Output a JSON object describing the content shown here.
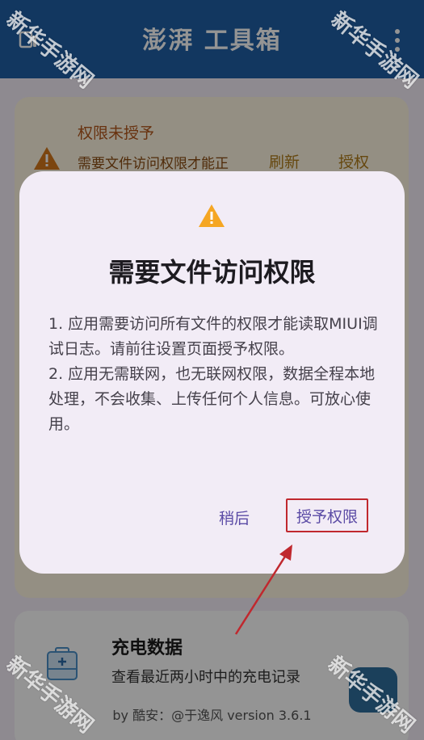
{
  "appbar": {
    "title": "澎湃 工具箱"
  },
  "warning_card": {
    "title": "权限未授予",
    "text": "需要文件访问权限才能正",
    "refresh_label": "刷新",
    "grant_label": "授权",
    "icon": "warning-icon"
  },
  "charge_card": {
    "title": "充电数据",
    "subtitle": "查看最近两小时中的充电记录",
    "icon": "battery-medical-icon"
  },
  "footer": {
    "text": "by 酷安：@于逸风 version 3.6.1"
  },
  "dialog": {
    "icon": "warning-icon",
    "title": "需要文件访问权限",
    "body_1": "1. 应用需要访问所有文件的权限才能读取MIUI调试日志。请前往设置页面授予权限。",
    "body_2": "2. 应用无需联网，也无联网权限，数据全程本地处理，不会收集、上传任何个人信息。可放心使用。",
    "later_label": "稍后",
    "grant_label": "授予权限"
  },
  "watermark": {
    "text": "新华手游网"
  },
  "colors": {
    "appbar": "#1f5fa6",
    "dialog_bg": "#f2ecf6",
    "accent": "#5a4aa5",
    "warning": "#f5a623",
    "annotation": "#c0282e"
  }
}
